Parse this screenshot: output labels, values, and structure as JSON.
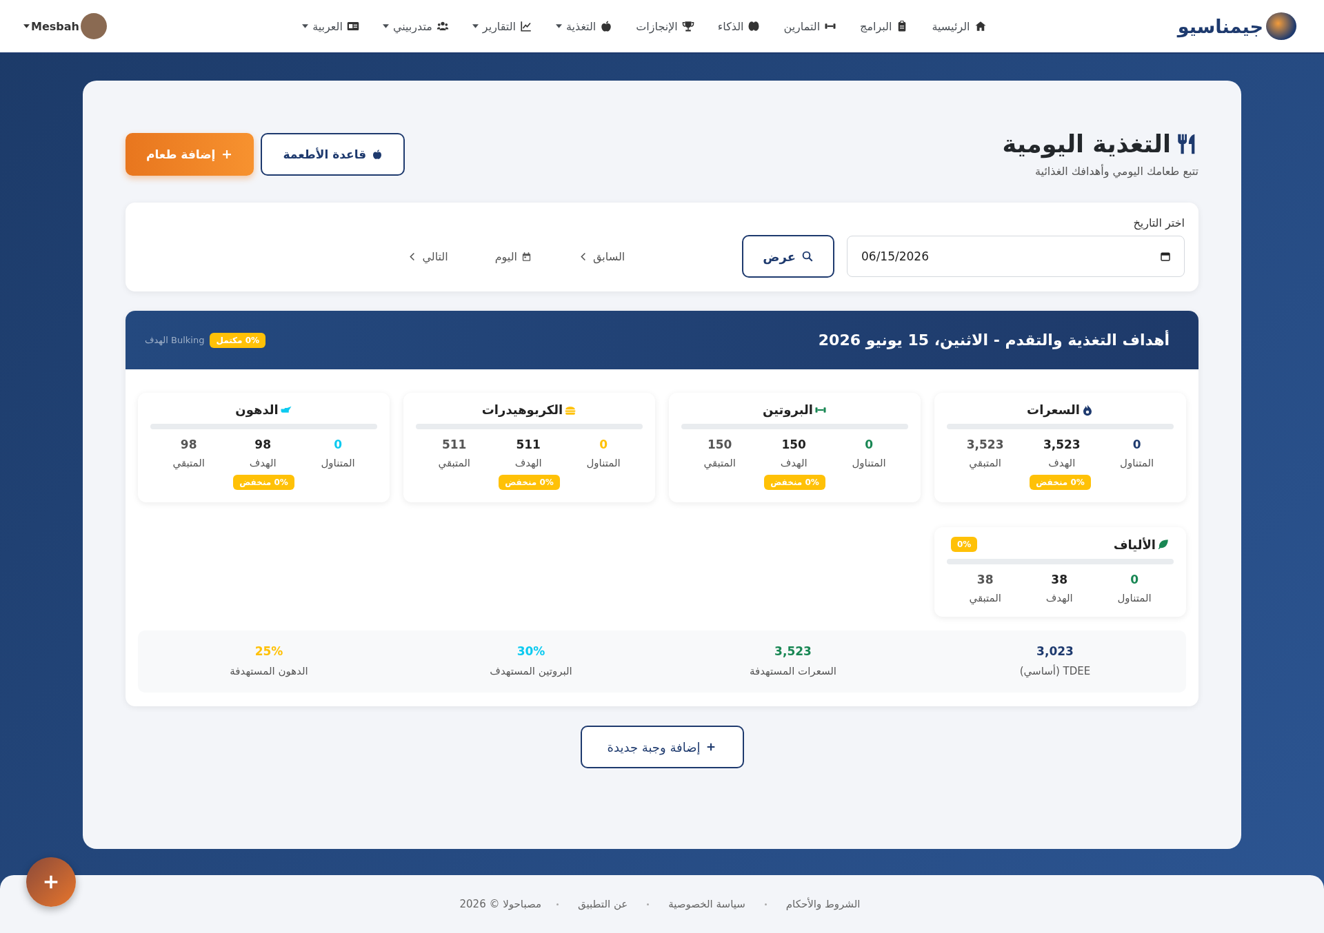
{
  "navbar": {
    "brand": "جيمناسيو",
    "items": [
      {
        "label": "الرئيسية",
        "dropdown": false
      },
      {
        "label": "البرامج",
        "dropdown": false
      },
      {
        "label": "التمارين",
        "dropdown": false
      },
      {
        "label": "الذكاء",
        "dropdown": false
      },
      {
        "label": "الإنجازات",
        "dropdown": false
      },
      {
        "label": "التغذية",
        "dropdown": true
      },
      {
        "label": "التقارير",
        "dropdown": true
      },
      {
        "label": "متدربيني",
        "dropdown": true
      },
      {
        "label": "العربية",
        "dropdown": true
      }
    ],
    "user": {
      "name": "Mesbah",
      "dropdown": true
    }
  },
  "header": {
    "title": "التغذية اليومية",
    "subtitle": "تتبع طعامك اليومي وأهدافك الغذائية",
    "buttons": [
      {
        "label": "قاعدة الأطعمة",
        "kind": "outline"
      },
      {
        "label": "إضافة طعام",
        "kind": "primary"
      }
    ]
  },
  "date_picker": {
    "label": "اختر التاريخ",
    "value": "06/15/2026",
    "submit": "عرض",
    "nav": [
      {
        "label": "السابق"
      },
      {
        "label": "اليوم"
      },
      {
        "label": "التالي"
      }
    ]
  },
  "goals": {
    "title": "أهداف التغذية والتقدم - الاثنين، 15 يونيو 2026",
    "progress_badge": "0% مكتمل",
    "goal_text": "الهدف Bulking",
    "macros": [
      {
        "kind": "full",
        "name": "السعرات",
        "color": "#1e3a6e",
        "level": 0,
        "stats": [
          {
            "label": "المتناول",
            "value": "0"
          },
          {
            "label": "الهدف",
            "value": "3,523"
          },
          {
            "label": "المتبقي",
            "value": "3,523"
          }
        ],
        "status": "0% منخفض"
      },
      {
        "kind": "full",
        "name": "البروتين",
        "color": "#198754",
        "level": 0,
        "stats": [
          {
            "label": "المتناول",
            "value": "0"
          },
          {
            "label": "الهدف",
            "value": "150"
          },
          {
            "label": "المتبقي",
            "value": "150"
          }
        ],
        "status": "0% منخفض"
      },
      {
        "kind": "full",
        "name": "الكربوهيدرات",
        "color": "#ffc107",
        "level": 0,
        "stats": [
          {
            "label": "المتناول",
            "value": "0"
          },
          {
            "label": "الهدف",
            "value": "511"
          },
          {
            "label": "المتبقي",
            "value": "511"
          }
        ],
        "status": "0% منخفض"
      },
      {
        "kind": "full",
        "name": "الدهون",
        "color": "#0dcaf0",
        "level": 0,
        "stats": [
          {
            "label": "المتناول",
            "value": "0"
          },
          {
            "label": "الهدف",
            "value": "98"
          },
          {
            "label": "المتبقي",
            "value": "98"
          }
        ],
        "status": "0% منخفض"
      },
      {
        "kind": "compact",
        "name": "الألياف",
        "color": "#198754",
        "level": 0,
        "stats": [
          {
            "label": "المتناول",
            "value": "0"
          },
          {
            "label": "الهدف",
            "value": "38"
          },
          {
            "label": "المتبقي",
            "value": "38"
          }
        ],
        "status": "0%"
      }
    ],
    "summary": [
      {
        "label": "TDEE (أساسي)",
        "value": "3,023",
        "color": "#1e3a6e"
      },
      {
        "label": "السعرات المستهدفة",
        "value": "3,523",
        "color": "#198754"
      },
      {
        "label": "البروتين المستهدف",
        "value": "30%",
        "color": "#0dcaf0"
      },
      {
        "label": "الدهون المستهدفة",
        "value": "25%",
        "color": "#ffc107"
      }
    ]
  },
  "add_meal": "إضافة وجبة جديدة",
  "footer": {
    "links": [
      "الشروط والأحكام",
      "سياسة الخصوصية",
      "عن التطبيق"
    ],
    "copyright": "مصباحولا © 2026"
  }
}
